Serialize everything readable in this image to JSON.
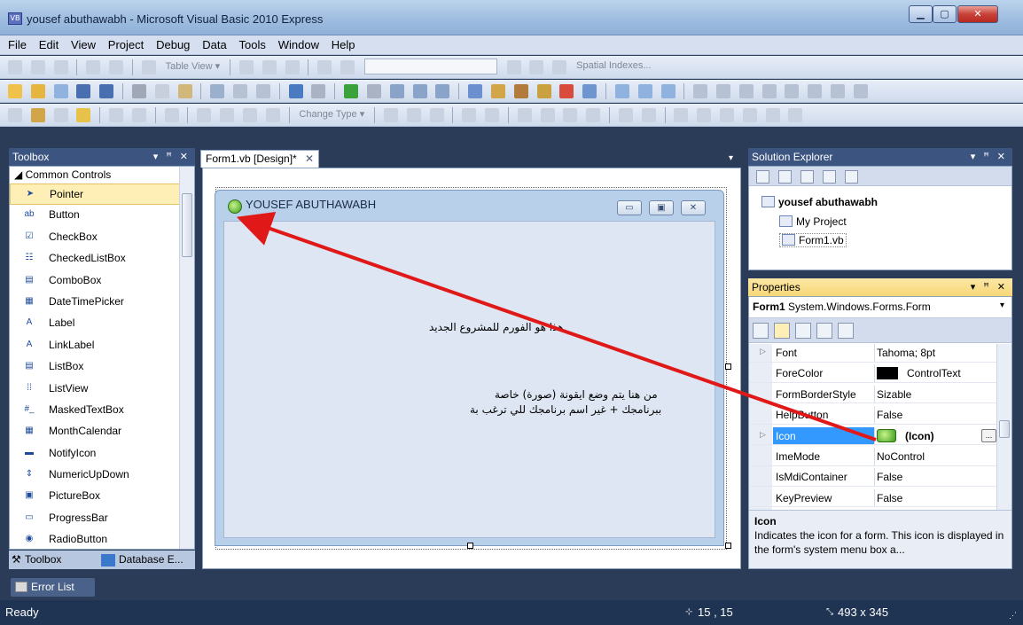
{
  "window": {
    "title": "yousef abuthawabh - Microsoft Visual Basic 2010 Express",
    "app_icon_text": "VB",
    "buttons": [
      "minimize",
      "maximize",
      "close"
    ]
  },
  "menu": [
    "File",
    "Edit",
    "View",
    "Project",
    "Debug",
    "Data",
    "Tools",
    "Window",
    "Help"
  ],
  "toolbars": {
    "row1_texts": [
      "Table View ▾",
      "Spatial Indexes..."
    ],
    "row3_texts": [
      "Change Type ▾"
    ]
  },
  "toolbox": {
    "title": "Toolbox",
    "title_controls": "▾ ꟸ ✕",
    "group": "◢ Common Controls",
    "items": [
      {
        "label": "Pointer",
        "icon": "pointer-icon",
        "glyph": "➤",
        "selected": true
      },
      {
        "label": "Button",
        "icon": "button-icon",
        "glyph": "ab"
      },
      {
        "label": "CheckBox",
        "icon": "checkbox-icon",
        "glyph": "☑"
      },
      {
        "label": "CheckedListBox",
        "icon": "checkedlistbox-icon",
        "glyph": "☷"
      },
      {
        "label": "ComboBox",
        "icon": "combobox-icon",
        "glyph": "▤"
      },
      {
        "label": "DateTimePicker",
        "icon": "datetimepicker-icon",
        "glyph": "▦"
      },
      {
        "label": "Label",
        "icon": "label-icon",
        "glyph": "A"
      },
      {
        "label": "LinkLabel",
        "icon": "linklabel-icon",
        "glyph": "A"
      },
      {
        "label": "ListBox",
        "icon": "listbox-icon",
        "glyph": "▤"
      },
      {
        "label": "ListView",
        "icon": "listview-icon",
        "glyph": "⁞⁞"
      },
      {
        "label": "MaskedTextBox",
        "icon": "maskedtextbox-icon",
        "glyph": "#_"
      },
      {
        "label": "MonthCalendar",
        "icon": "monthcalendar-icon",
        "glyph": "▦"
      },
      {
        "label": "NotifyIcon",
        "icon": "notifyicon-icon",
        "glyph": "▬"
      },
      {
        "label": "NumericUpDown",
        "icon": "numericupdown-icon",
        "glyph": "⇕"
      },
      {
        "label": "PictureBox",
        "icon": "picturebox-icon",
        "glyph": "▣"
      },
      {
        "label": "ProgressBar",
        "icon": "progressbar-icon",
        "glyph": "▭"
      },
      {
        "label": "RadioButton",
        "icon": "radiobutton-icon",
        "glyph": "◉"
      }
    ],
    "bottom_tabs": [
      "Toolbox",
      "Database E..."
    ]
  },
  "document": {
    "tab_label": "Form1.vb [Design]*",
    "tab_close": "✕",
    "form_caption": "YOUSEF ABUTHAWABH",
    "label1": "هذا هو الفورم للمشروع الجديد",
    "label2_line1": "من هنا يتم وضع ايقونة (صورة) خاصة",
    "label2_line2": "ببرنامجك + غير اسم برنامجك للي ترغب بة"
  },
  "solution_explorer": {
    "title": "Solution Explorer",
    "title_controls": "▾ ꟸ ✕",
    "project": "yousef abuthawabh",
    "items": [
      "My Project",
      "Form1.vb"
    ]
  },
  "properties": {
    "title": "Properties",
    "title_controls": "▾ ꟸ ✕",
    "object_name": "Form1",
    "object_type": "System.Windows.Forms.Form",
    "rows": [
      {
        "name": "Font",
        "value": "Tahoma; 8pt",
        "expandable": true
      },
      {
        "name": "ForeColor",
        "value": "ControlText",
        "swatch": "#000000"
      },
      {
        "name": "FormBorderStyle",
        "value": "Sizable"
      },
      {
        "name": "HelpButton",
        "value": "False"
      },
      {
        "name": "Icon",
        "value": "(Icon)",
        "expandable": true,
        "selected": true
      },
      {
        "name": "ImeMode",
        "value": "NoControl"
      },
      {
        "name": "IsMdiContainer",
        "value": "False"
      },
      {
        "name": "KeyPreview",
        "value": "False"
      }
    ],
    "desc_title": "Icon",
    "desc_text": "Indicates the icon for a form. This icon is displayed in the form's system menu box a..."
  },
  "error_list": "Error List",
  "status": {
    "text": "Ready",
    "position": "15 , 15",
    "size": "493 x 345"
  },
  "colors": {
    "accent_arrow": "#e01818",
    "selection": "#3399ff",
    "panel_title": "#3c5580"
  }
}
